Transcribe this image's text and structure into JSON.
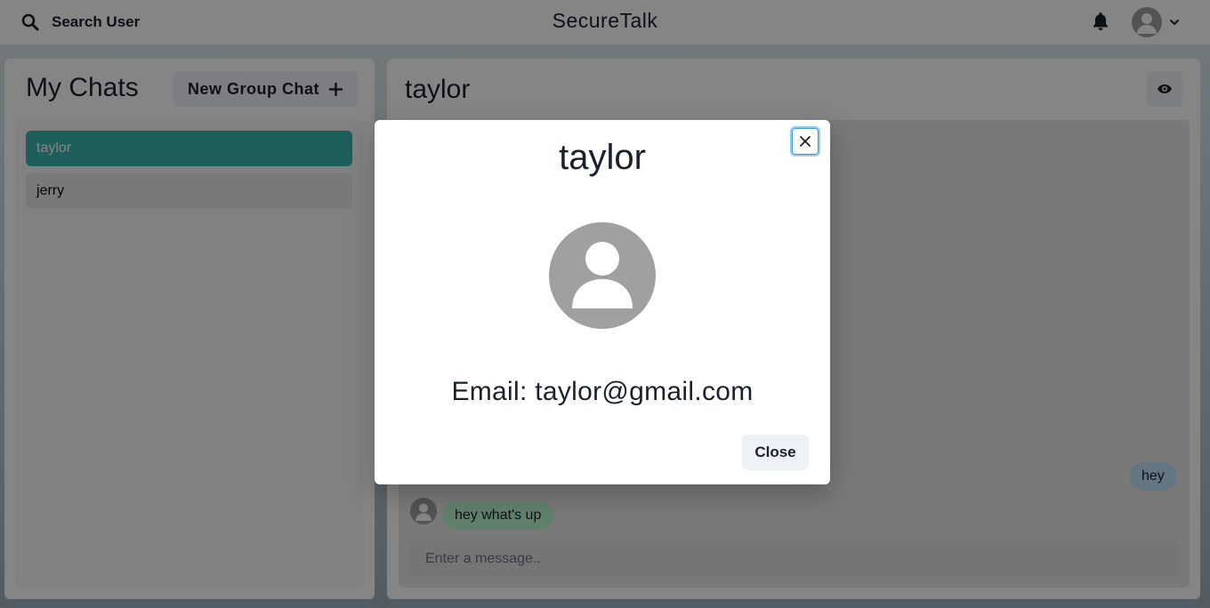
{
  "topbar": {
    "search_label": "Search User",
    "app_title": "SecureTalk"
  },
  "chats": {
    "header": "My Chats",
    "new_group_label": "New Group Chat",
    "items": [
      {
        "label": "taylor",
        "active": true
      },
      {
        "label": "jerry",
        "active": false
      }
    ]
  },
  "chat": {
    "title": "taylor",
    "messages": [
      {
        "text": "hey",
        "direction": "outgoing"
      },
      {
        "text": "hey what's up",
        "direction": "incoming"
      }
    ],
    "input_placeholder": "Enter a message.."
  },
  "modal": {
    "title": "taylor",
    "email_text": "Email: taylor@gmail.com",
    "close_label": "Close"
  },
  "colors": {
    "accent": "#38b2ac",
    "outgoing_bubble": "#bee3f8",
    "incoming_bubble": "#b9f5d0"
  }
}
